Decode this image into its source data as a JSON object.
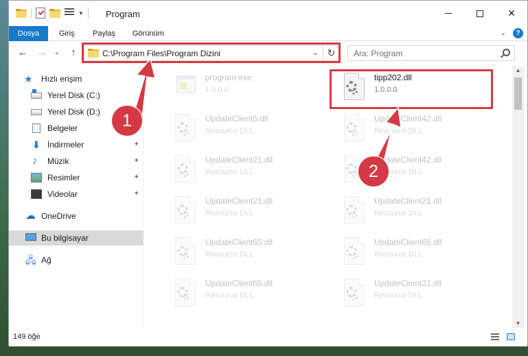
{
  "window": {
    "title": "Program",
    "controls": {
      "minimize": "—",
      "maximize": "☐",
      "close": "✕"
    }
  },
  "ribbon": {
    "tabs": [
      "Dosya",
      "Giriş",
      "Paylaş",
      "Görünüm"
    ],
    "expand": "⌄",
    "help": "?"
  },
  "nav": {
    "back": "←",
    "forward": "→",
    "recent": "⌄",
    "up": "↑",
    "address": "C:\\Program Files\\Program Dizini",
    "address_dropdown": "⌄",
    "refresh": "↻",
    "search_placeholder": "Ara: Program"
  },
  "sidebar": {
    "items": [
      {
        "label": "Hızlı erişim",
        "icon": "star-icon"
      },
      {
        "label": "Yerel Disk (C:)",
        "icon": "windows-drive-icon"
      },
      {
        "label": "Yerel Disk (D:)",
        "icon": "drive-icon"
      },
      {
        "label": "Belgeler",
        "icon": "documents-icon"
      },
      {
        "label": "İndirmeler",
        "icon": "downloads-icon",
        "pinned": true
      },
      {
        "label": "Müzik",
        "icon": "music-icon",
        "pinned": true
      },
      {
        "label": "Resimler",
        "icon": "pictures-icon",
        "pinned": true
      },
      {
        "label": "Videolar",
        "icon": "videos-icon",
        "pinned": true
      },
      {
        "label": "OneDrive",
        "icon": "onedrive-icon"
      },
      {
        "label": "Bu bilgisayar",
        "icon": "this-pc-icon",
        "selected": true
      },
      {
        "label": "Ağ",
        "icon": "network-icon"
      }
    ],
    "pin_glyph": "📌"
  },
  "files": [
    {
      "name": "program.exe",
      "sub": "1.0.0.0",
      "icon": "exe-icon",
      "faded": true
    },
    {
      "name": "tipp202.dll",
      "sub": "1.0.0.0",
      "icon": "dll-icon",
      "faded": false
    },
    {
      "name": "UpdateClient5.dll",
      "sub": "Resource DLL",
      "icon": "dll-icon",
      "faded": true
    },
    {
      "name": "UpdateClient42.dll",
      "sub": "Resource DLL",
      "icon": "dll-icon",
      "faded": true
    },
    {
      "name": "UpdateClient21.dll",
      "sub": "Resource DLL",
      "icon": "dll-icon",
      "faded": true
    },
    {
      "name": "UpdateClient42.dll",
      "sub": "Resource DLL",
      "icon": "dll-icon",
      "faded": true
    },
    {
      "name": "UpdateClient21.dll",
      "sub": "Resource DLL",
      "icon": "dll-icon",
      "faded": true
    },
    {
      "name": "UpdateClient21.dll",
      "sub": "Resource DLL",
      "icon": "dll-icon",
      "faded": true
    },
    {
      "name": "UpdateClient65.dll",
      "sub": "Resource DLL",
      "icon": "dll-icon",
      "faded": true
    },
    {
      "name": "UpdateClient65.dll",
      "sub": "Resource DLL",
      "icon": "dll-icon",
      "faded": true
    },
    {
      "name": "UpdateClient65.dll",
      "sub": "Resource DLL",
      "icon": "dll-icon",
      "faded": true
    },
    {
      "name": "UpdateClient21.dll",
      "sub": "Resource DLL",
      "icon": "dll-icon",
      "faded": true
    }
  ],
  "status": {
    "count": "149 öğe"
  },
  "annotations": {
    "callout1": "1",
    "callout2": "2",
    "color": "#d53a44"
  },
  "colors": {
    "accent": "#1979ca",
    "annotation": "#d53a44",
    "selected_nav": "#d9d9d9"
  }
}
